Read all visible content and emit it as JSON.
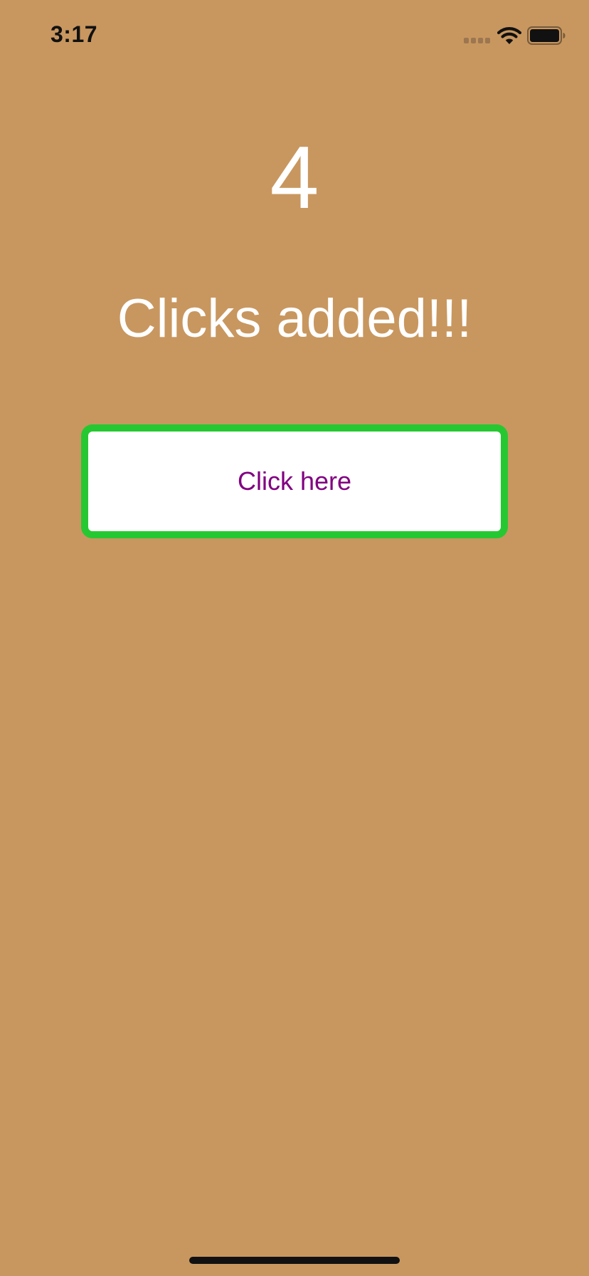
{
  "status_bar": {
    "time": "3:17",
    "icons": [
      "signal-icon",
      "wifi-icon",
      "battery-icon"
    ],
    "battery_level": 1.0
  },
  "counter": {
    "value": "4"
  },
  "message": {
    "text": "Clicks added!!!"
  },
  "button": {
    "label": "Click here"
  },
  "colors": {
    "background": "#c8975f",
    "text": "#ffffff",
    "button_border": "#26c832",
    "button_background": "#ffffff",
    "button_label": "#800080"
  }
}
